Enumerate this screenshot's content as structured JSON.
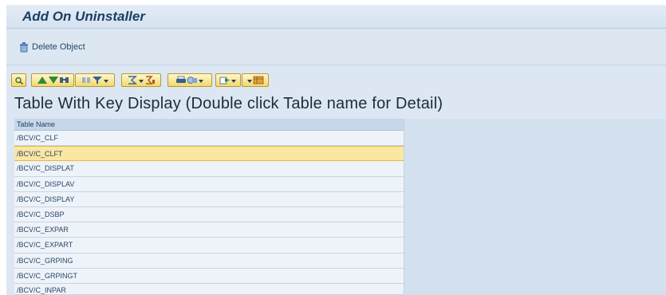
{
  "window": {
    "title": "Add On Uninstaller"
  },
  "app_toolbar": {
    "delete_label": "Delete Object"
  },
  "alv_toolbar": {
    "buttons": [
      {
        "icon": "details-icon"
      },
      {
        "icon": "sort-ascending-icon"
      },
      {
        "icon": "sort-descending-icon"
      },
      {
        "icon": "find-icon"
      },
      {
        "icon": "find-next-icon"
      },
      {
        "icon": "filter-icon"
      },
      {
        "icon": "sum-icon"
      },
      {
        "icon": "subtotal-icon"
      },
      {
        "icon": "print-icon"
      },
      {
        "icon": "views-icon"
      },
      {
        "icon": "export-icon"
      },
      {
        "icon": "layout-icon"
      }
    ]
  },
  "heading": "Table With Key Display (Double click Table name for Detail)",
  "table": {
    "column_header": "Table Name",
    "rows": [
      "/BCV/C_CLF",
      "/BCV/C_CLFT",
      "/BCV/C_DISPLAT",
      "/BCV/C_DISPLAV",
      "/BCV/C_DISPLAY",
      "/BCV/C_DSBP",
      "/BCV/C_EXPAR",
      "/BCV/C_EXPART",
      "/BCV/C_GRPING",
      "/BCV/C_GRPINGT",
      "/BCV/C_INPAR"
    ],
    "selected_row": "/BCV/C_CLFT"
  },
  "colors": {
    "selection": "#fbe6a2",
    "background": "#dce7f3",
    "title": "#1b3f66"
  }
}
